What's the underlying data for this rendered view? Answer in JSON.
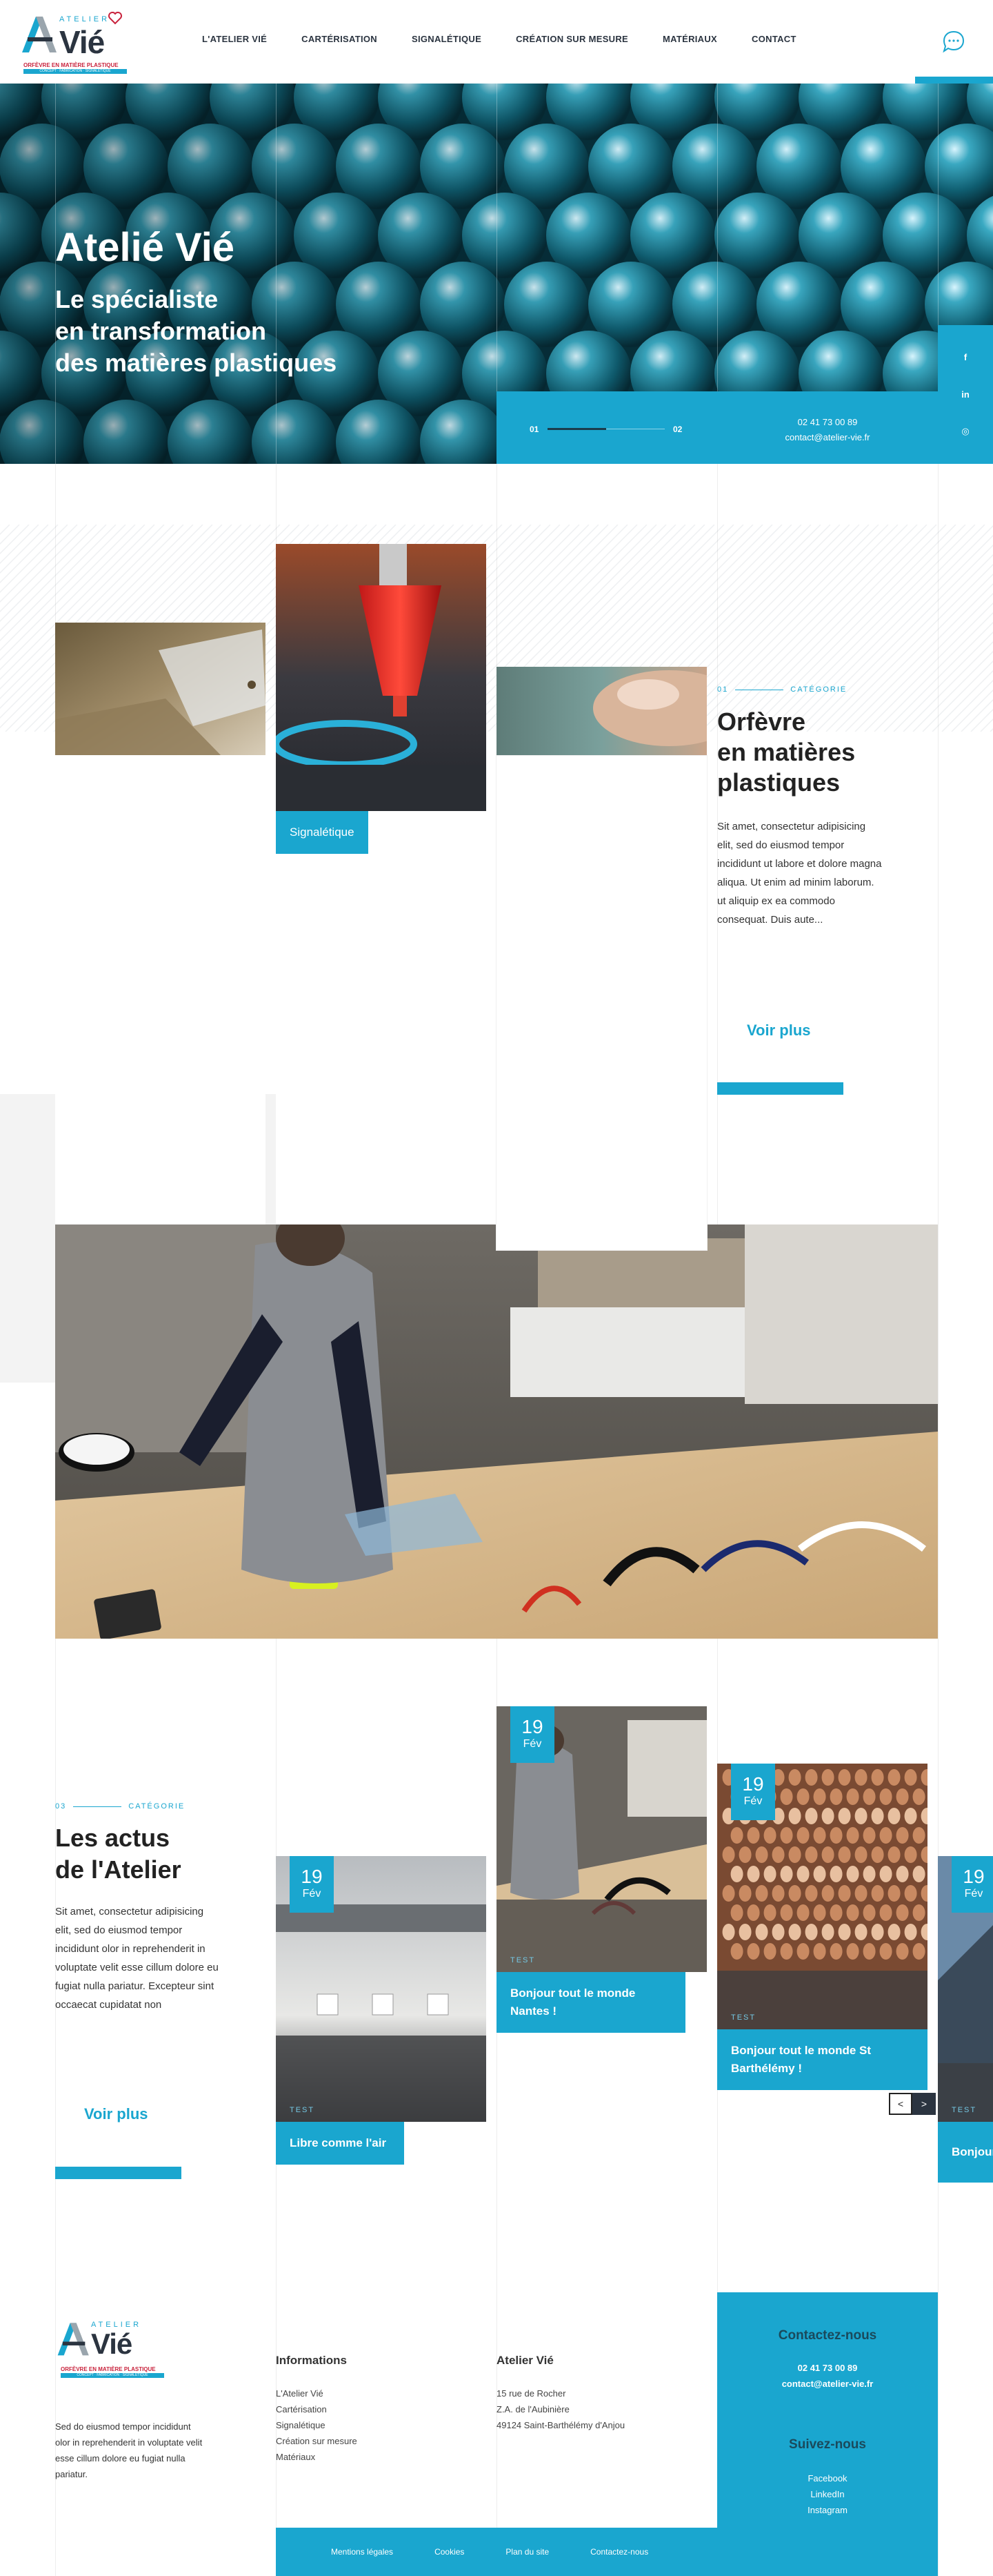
{
  "colors": {
    "accent": "#1aa6cf",
    "dark": "#2b3440",
    "brand_red": "#c8223c"
  },
  "header": {
    "logo": {
      "atelier": "ATELIER",
      "vie": "Vié",
      "tagline1": "ORFÈVRE EN MATIÈRE PLASTIQUE",
      "tagline2": "CONCEPT · FABRICATION · SIGNALÉTIQUE"
    },
    "nav": [
      "L'ATELIER VIÉ",
      "CARTÉRISATION",
      "SIGNALÉTIQUE",
      "CRÉATION SUR MESURE",
      "MATÉRIAUX",
      "CONTACT"
    ],
    "chat_icon": "chat-bubble-icon"
  },
  "hero": {
    "title": "Atelié Vié",
    "subtitle_lines": [
      "Le spécialiste",
      "en transformation",
      "des matières plastiques"
    ],
    "slider": {
      "current": "01",
      "total": "02",
      "progress": 0.5
    },
    "phone": "02 41 73 00 89",
    "email": "contact@atelier-vie.fr",
    "social": [
      {
        "icon": "facebook-icon",
        "glyph": "f"
      },
      {
        "icon": "linkedin-icon",
        "glyph": "in"
      },
      {
        "icon": "instagram-icon",
        "glyph": "◎"
      }
    ]
  },
  "section1": {
    "number": "01",
    "category": "CATÉGORIE",
    "title_lines": [
      "Orfèvre",
      "en matières",
      "plastiques"
    ],
    "text": "Sit amet, consectetur adipisicing elit, sed do eiusmod tempor incididunt ut labore et dolore magna aliqua. Ut enim ad minim laborum. ut aliquip ex ea commodo consequat. Duis aute...",
    "cta": "Voir plus",
    "image_tag": "Signalétique"
  },
  "section3": {
    "number": "03",
    "category": "CATÉGORIE",
    "title_lines": [
      "Les actus",
      "de l'Atelier"
    ],
    "text": "Sit amet, consectetur adipisicing elit, sed do eiusmod tempor incididunt olor in reprehenderit in voluptate velit esse cillum dolore eu fugiat nulla pariatur. Excepteur sint occaecat cupidatat non",
    "cta": "Voir plus",
    "news": [
      {
        "day": "19",
        "month": "Fév",
        "tag": "TEST",
        "title": "Libre comme l'air"
      },
      {
        "day": "19",
        "month": "Fév",
        "tag": "TEST",
        "title": "Bonjour tout le monde Nantes !"
      },
      {
        "day": "19",
        "month": "Fév",
        "tag": "TEST",
        "title": "Bonjour tout le monde St Barthélémy !"
      },
      {
        "day": "19",
        "month": "Fév",
        "tag": "TEST",
        "title": "Bonjour tout le monde"
      }
    ],
    "arrows": {
      "prev": "<",
      "next": ">"
    }
  },
  "footer": {
    "about": "Sed do eiusmod tempor incididunt olor in reprehenderit in voluptate velit esse cillum dolore eu fugiat nulla pariatur.",
    "info_title": "Informations",
    "info_links": [
      "L'Atelier Vié",
      "Cartérisation",
      "Signalétique",
      "Création sur mesure",
      "Matériaux"
    ],
    "address_title": "Atelier Vié",
    "address_lines": [
      "15 rue de Rocher",
      "Z.A. de l'Aubinière",
      "49124 Saint-Barthélémy d'Anjou"
    ],
    "contact_title": "Contactez-nous",
    "phone": "02 41 73 00 89",
    "email": "contact@atelier-vie.fr",
    "follow_title": "Suivez-nous",
    "follow_links": [
      "Facebook",
      "LinkedIn",
      "Instagram"
    ],
    "bottom_links": [
      "Mentions légales",
      "Cookies",
      "Plan du site",
      "Contactez-nous"
    ]
  }
}
